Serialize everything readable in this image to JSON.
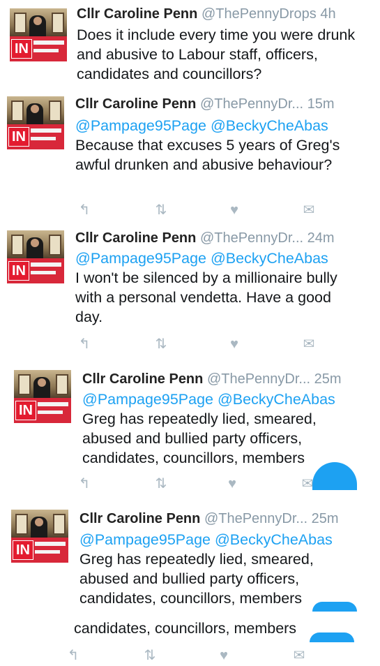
{
  "tweets": [
    {
      "author": "Cllr Caroline Penn",
      "handle": "@ThePennyDrops",
      "time": "4h",
      "mentions": "",
      "text": "Does it include every time you were drunk and abusive to Labour staff, officers, candidates and councillors?"
    },
    {
      "author": "Cllr Caroline Penn",
      "handle": "@ThePennyDr...",
      "time": "15m",
      "mentions": "@Pampage95Page @BeckyCheAbas",
      "text": "Because that excuses 5 years of Greg's awful drunken and abusive behaviour?"
    },
    {
      "author": "Cllr Caroline Penn",
      "handle": "@ThePennyDr...",
      "time": "24m",
      "mentions": "@Pampage95Page @BeckyCheAbas",
      "text": "I won't be silenced by a millionaire bully with a personal vendetta. Have a good day."
    },
    {
      "author": "Cllr Caroline Penn",
      "handle": "@ThePennyDr...",
      "time": "25m",
      "mentions": "@Pampage95Page @BeckyCheAbas",
      "text": "Greg has repeatedly lied, smeared, abused and bullied party officers, candidates, councillors, members"
    },
    {
      "author": "Cllr Caroline Penn",
      "handle": "@ThePennyDr...",
      "time": "25m",
      "mentions": "@Pampage95Page @BeckyCheAbas",
      "text": "Greg has repeatedly lied, smeared, abused and bullied party officers, candidates, councillors, members"
    }
  ],
  "overflow_text": "candidates, councillors, members",
  "avatar_badge": "IN",
  "icons": {
    "reply": "reply-icon",
    "retweet": "retweet-icon",
    "like": "heart-icon",
    "dm": "direct-message-icon"
  },
  "colors": {
    "link": "#1da1f2",
    "muted": "#8899a6",
    "icon": "#aab8c2"
  }
}
